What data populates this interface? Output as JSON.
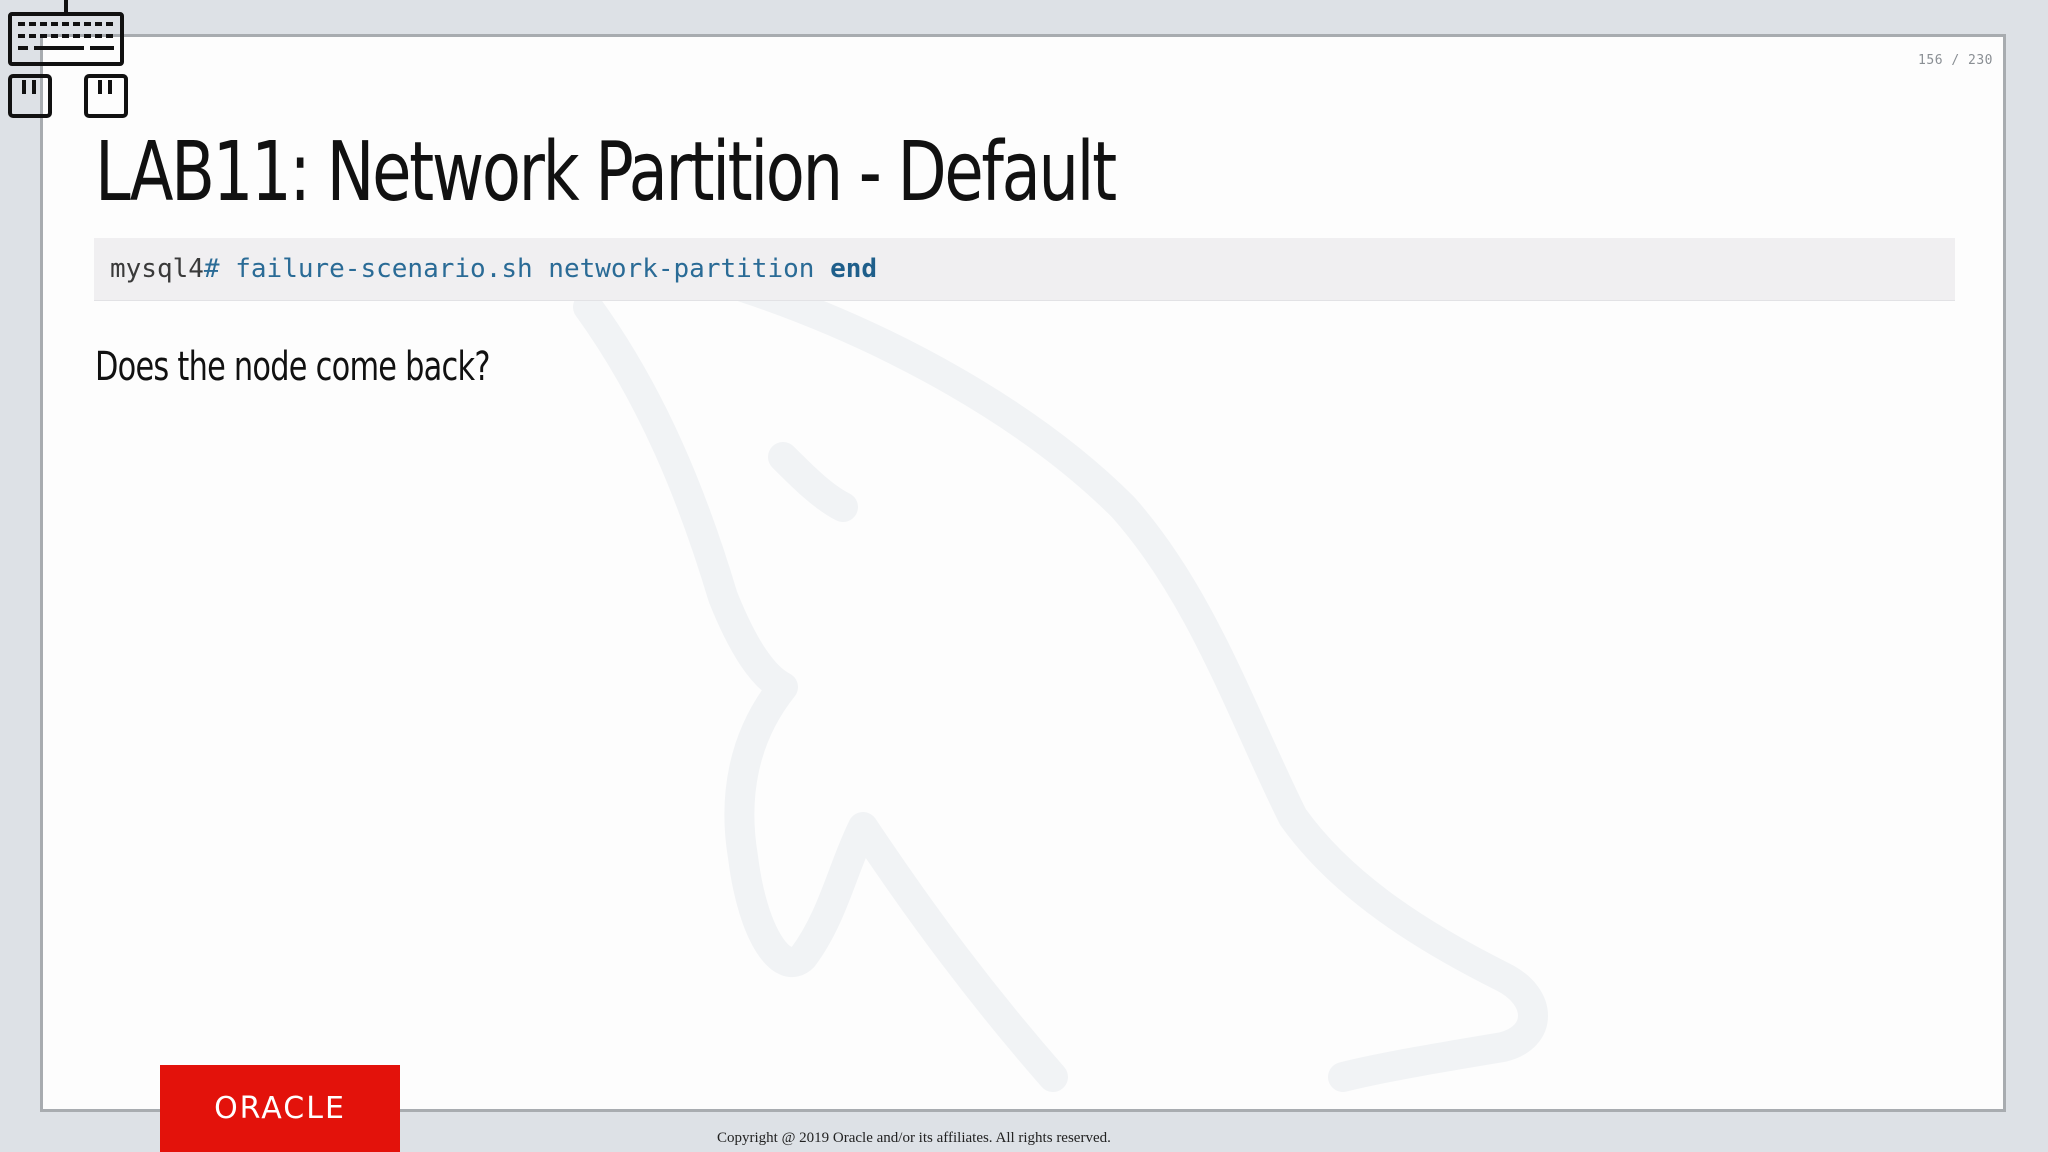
{
  "slide": {
    "page_counter": "156 / 230",
    "title": "LAB11: Network Partition - Default",
    "code": {
      "prompt_host": "mysql4",
      "prompt_hash": "#",
      "command": "failure-scenario.sh network-partition",
      "command_end": "end"
    },
    "question": "Does the node come back?"
  },
  "footer": {
    "logo_text": "ORACLE",
    "copyright": "Copyright @ 2019 Oracle and/or its affiliates. All rights reserved."
  },
  "icons": {
    "keyboard": "keyboard-icon",
    "watermark": "dolphin-watermark"
  },
  "colors": {
    "oracle_red": "#e3120b",
    "code_blue": "#2a6b96",
    "slide_background": "#fdfdfd",
    "viewport_background": "#dde1e6"
  }
}
